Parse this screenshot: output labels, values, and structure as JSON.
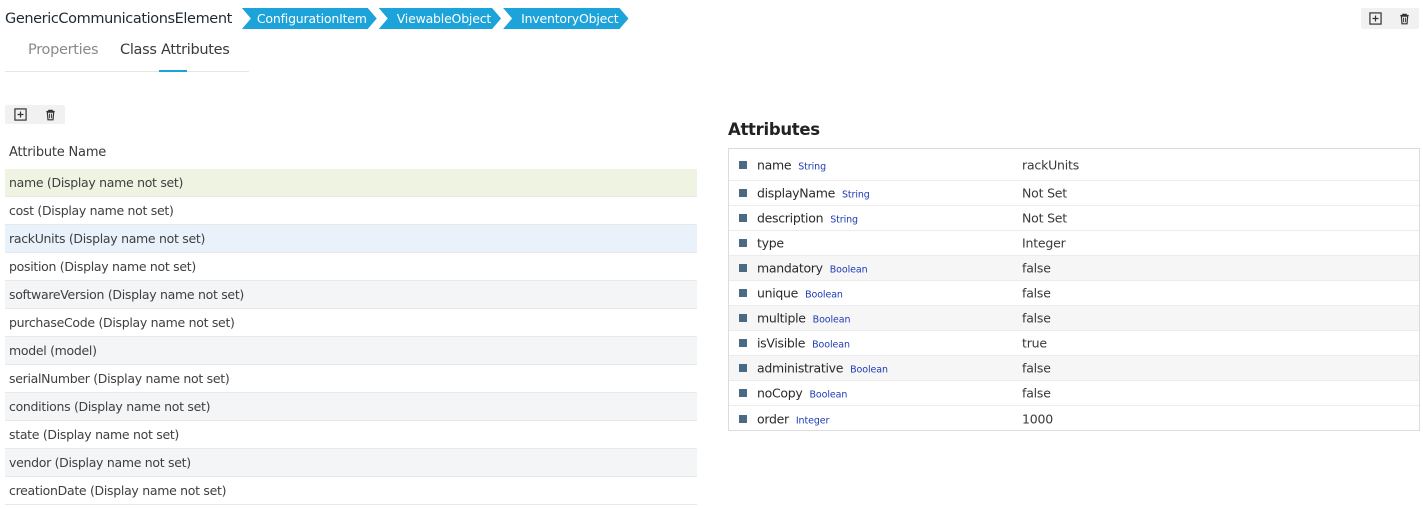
{
  "header": {
    "class_name": "GenericCommunicationsElement",
    "breadcrumbs": [
      "ConfigurationItem",
      "ViewableObject",
      "InventoryObject"
    ]
  },
  "tabs": [
    {
      "label": "Properties",
      "active": false
    },
    {
      "label": "Class Attributes",
      "active": true
    }
  ],
  "icons": {
    "add": "plus-square-icon",
    "delete": "trash-icon"
  },
  "attribute_list": {
    "header": "Attribute Name",
    "items": [
      "name (Display name not set)",
      "cost (Display name not set)",
      "rackUnits (Display name not set)",
      "position (Display name not set)",
      "softwareVersion (Display name not set)",
      "purchaseCode (Display name not set)",
      "model (model)",
      "serialNumber (Display name not set)",
      "conditions (Display name not set)",
      "state (Display name not set)",
      "vendor (Display name not set)",
      "creationDate (Display name not set)"
    ],
    "selected_index": 2
  },
  "attributes_panel": {
    "title": "Attributes",
    "rows": [
      {
        "name": "name",
        "type": "String",
        "value": "rackUnits"
      },
      {
        "name": "displayName",
        "type": "String",
        "value": "Not Set"
      },
      {
        "name": "description",
        "type": "String",
        "value": "Not Set"
      },
      {
        "name": "type",
        "type": "",
        "value": "Integer"
      },
      {
        "name": "mandatory",
        "type": "Boolean",
        "value": "false"
      },
      {
        "name": "unique",
        "type": "Boolean",
        "value": "false"
      },
      {
        "name": "multiple",
        "type": "Boolean",
        "value": "false"
      },
      {
        "name": "isVisible",
        "type": "Boolean",
        "value": "true"
      },
      {
        "name": "administrative",
        "type": "Boolean",
        "value": "false"
      },
      {
        "name": "noCopy",
        "type": "Boolean",
        "value": "false"
      },
      {
        "name": "order",
        "type": "Integer",
        "value": "1000"
      }
    ]
  },
  "colors": {
    "accent": "#1ca3d9",
    "type_label": "#1d3bb5",
    "bullet": "#4a6a83",
    "selected_row": "#e9f2fb",
    "first_row": "#eef3e2"
  }
}
